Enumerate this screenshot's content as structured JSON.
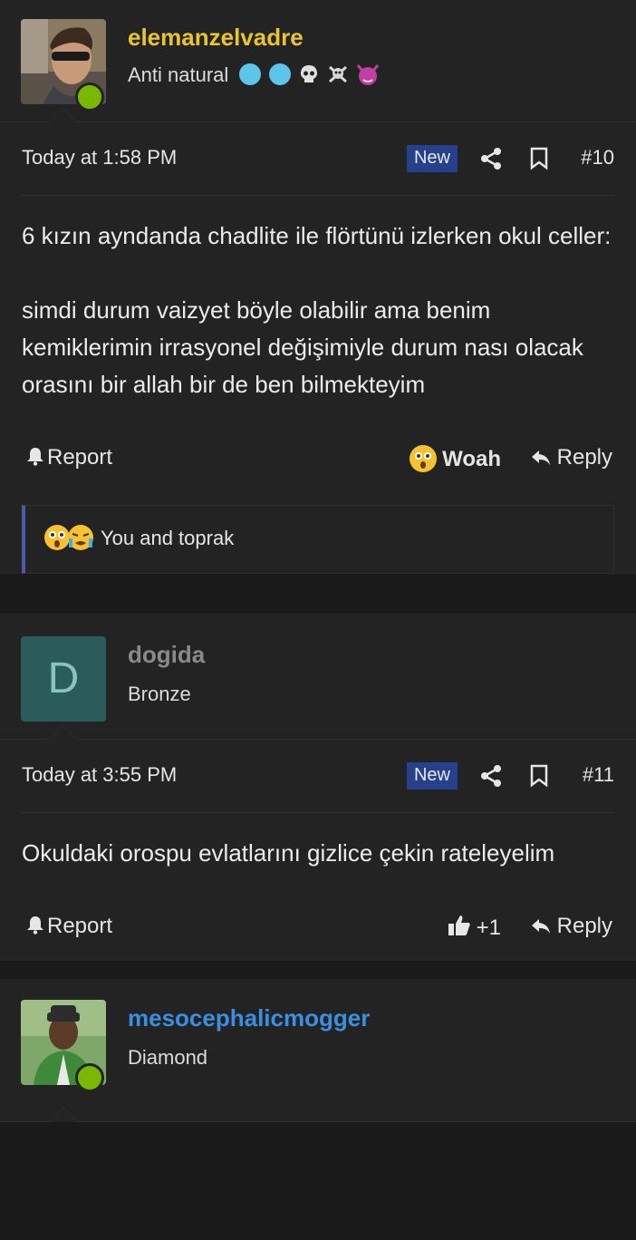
{
  "posts": [
    {
      "username": "elemanzelvadre",
      "username_color": "#e8c530",
      "user_title": "Anti natural",
      "user_title_icons": [
        "cold-face-icon",
        "cold-face-icon",
        "skull-icon",
        "skull-crossbones-icon",
        "devil-face-icon"
      ],
      "online": true,
      "date": "Today at 1:58 PM",
      "new_label": "New",
      "number": "#10",
      "paragraphs": [
        "6 kızın ayndanda chadlite ile flörtünü izlerken okul celler:",
        "simdi durum vaizyet böyle olabilir ama benim kemiklerimin irrasyonel değişimiyle durum nası olacak orasını bir allah bir de ben bilmekteyim"
      ],
      "report_label": "Report",
      "reaction_label": "Woah",
      "reply_label": "Reply",
      "reactions_summary": "You and toprak"
    },
    {
      "username": "dogida",
      "username_color": "#8a8a8a",
      "avatar_letter": "D",
      "user_title": "Bronze",
      "date": "Today at 3:55 PM",
      "new_label": "New",
      "number": "#11",
      "paragraphs": [
        "Okuldaki orospu evlatlarını gizlice çekin rateleyelim"
      ],
      "report_label": "Report",
      "like_label": "+1",
      "reply_label": "Reply"
    },
    {
      "username": "mesocephalicmogger",
      "username_color": "#3a8fe0",
      "user_title": "Diamond",
      "online": true
    }
  ]
}
